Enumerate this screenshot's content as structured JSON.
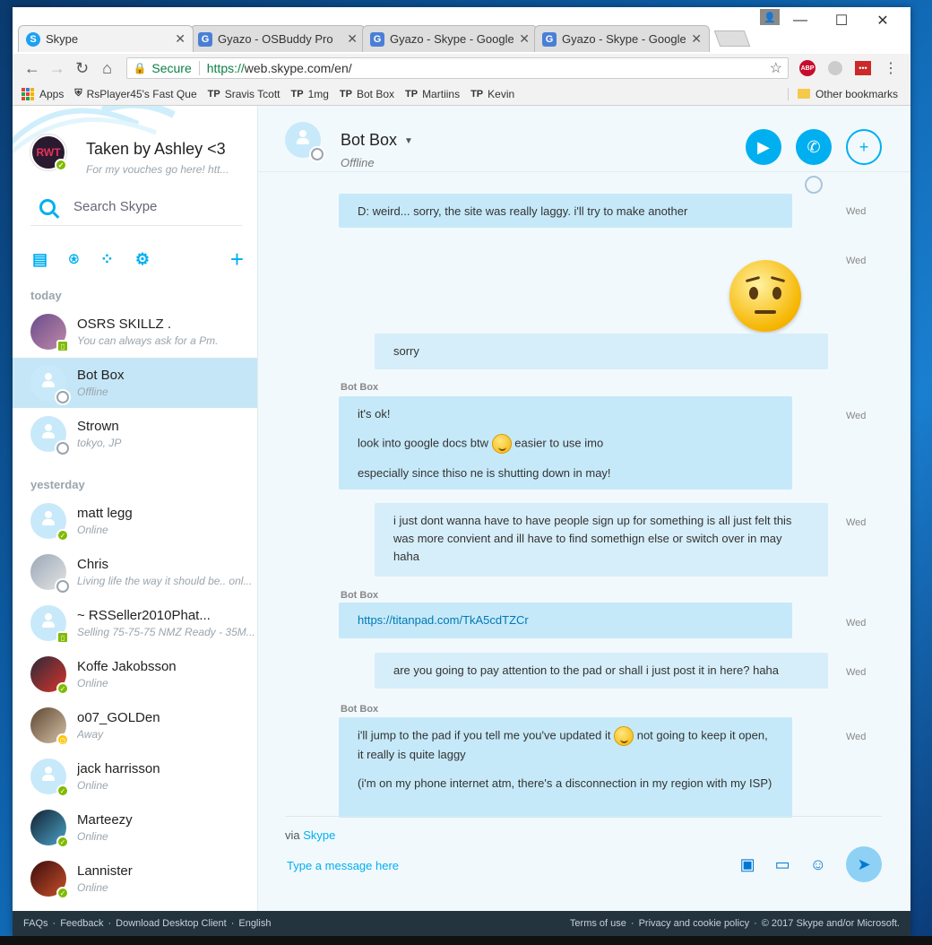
{
  "browser": {
    "tabs": [
      {
        "title": "Skype",
        "icon": "skype-icon",
        "active": true
      },
      {
        "title": "Gyazo - OSBuddy Pro",
        "icon": "gyazo-icon"
      },
      {
        "title": "Gyazo - Skype - Google (",
        "icon": "gyazo-icon"
      },
      {
        "title": "Gyazo - Skype - Google (",
        "icon": "gyazo-icon"
      }
    ],
    "secure_label": "Secure",
    "url_scheme": "https://",
    "url_rest": "web.skype.com/en/",
    "bookmarks": [
      {
        "label": "Apps"
      },
      {
        "label": "RsPlayer45's Fast Que"
      },
      {
        "label": "Sravis Tcott",
        "prefix": "TP"
      },
      {
        "label": "1mg",
        "prefix": "TP"
      },
      {
        "label": "Bot Box",
        "prefix": "TP"
      },
      {
        "label": "Martiins",
        "prefix": "TP"
      },
      {
        "label": "Kevin",
        "prefix": "TP"
      }
    ],
    "other_bookmarks": "Other bookmarks",
    "ext_abp": "ABP",
    "ext_lastpass": "•••"
  },
  "me": {
    "name": "Taken by Ashley <3",
    "mood": "For my vouches go here! htt...",
    "avatar_text": "RWT"
  },
  "search": {
    "placeholder": "Search Skype"
  },
  "groups": {
    "today": "today",
    "yesterday": "yesterday"
  },
  "contacts": [
    {
      "name": "OSRS SKILLZ .",
      "mood": "You can always ask for a Pm.",
      "status": "mobile"
    },
    {
      "name": "Bot Box",
      "mood": "Offline",
      "status": "offline"
    },
    {
      "name": "Strown",
      "mood": "tokyo, JP",
      "status": "offline"
    },
    {
      "name": "matt legg",
      "mood": "Online",
      "status": "online"
    },
    {
      "name": "Chris",
      "mood": "Living life the way it should be.. onl...",
      "status": "offline"
    },
    {
      "name": "~ RSSeller2010Phat...",
      "mood": "Selling 75-75-75 NMZ Ready - 35M...",
      "status": "mobile"
    },
    {
      "name": "Koffe Jakobsson",
      "mood": "Online",
      "status": "online"
    },
    {
      "name": "o07_GOLDen",
      "mood": "Away",
      "status": "away"
    },
    {
      "name": "jack harrisson",
      "mood": "Online",
      "status": "online"
    },
    {
      "name": "Marteezy",
      "mood": "Online",
      "status": "online"
    },
    {
      "name": "Lannister",
      "mood": "Online",
      "status": "online"
    }
  ],
  "chat": {
    "name": "Bot Box",
    "status": "Offline",
    "sender": "Bot Box",
    "day": "Wed",
    "messages": {
      "m1": "D: weird... sorry, the site was really laggy. i'll try to make another",
      "m2": "sorry",
      "m3a": "it's ok!",
      "m3b1": "look into google docs btw",
      "m3b2": "easier to use imo",
      "m3c": "especially since thiso ne is shutting down in may!",
      "m4": "i just dont wanna have to have people sign up for something is all just felt this was more convient and ill have to find somethign else or switch over in may haha",
      "m5": "https://titanpad.com/TkA5cdTZCr",
      "m6": "are you going to pay attention to the pad or shall i just post it in here? haha",
      "m7a1": "i'll jump to the pad if you tell me you've updated it",
      "m7a2": "not going to keep it open, it really is quite laggy",
      "m7b": "(i'm on my phone internet atm, there's a disconnection in my region with my ISP)"
    }
  },
  "composer": {
    "via": "via",
    "via_link": "Skype",
    "placeholder": "Type a message here"
  },
  "footer": {
    "faqs": "FAQs",
    "feedback": "Feedback",
    "download": "Download Desktop Client",
    "language": "English",
    "terms": "Terms of use",
    "privacy": "Privacy and cookie policy",
    "copyright": "© 2017 Skype and/or Microsoft."
  }
}
